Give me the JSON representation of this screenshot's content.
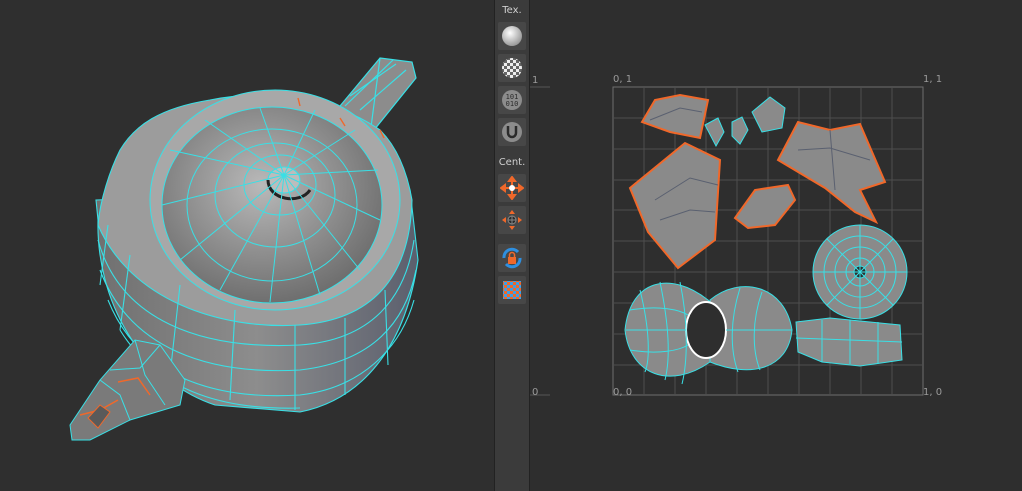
{
  "toolbar": {
    "texture_section_label": "Tex.",
    "center_section_label": "Cent.",
    "buttons": [
      {
        "name": "shaded-sphere-icon"
      },
      {
        "name": "checker-pattern-icon"
      },
      {
        "name": "binary-digits-icon"
      },
      {
        "name": "magnet-icon"
      },
      {
        "name": "center-move-icon"
      },
      {
        "name": "center-scatter-icon"
      },
      {
        "name": "rotate-lock-icon"
      },
      {
        "name": "checker-tile-icon"
      }
    ]
  },
  "uv_editor": {
    "corner_top_left": "0, 1",
    "corner_top_right": "1, 1",
    "corner_bottom_left": "0, 0",
    "corner_bottom_right": "1, 0",
    "ruler_top": "1",
    "ruler_bottom": "0"
  },
  "colors": {
    "wire": "#39e0e6",
    "seam": "#f0682a",
    "mesh_fill": "#8a8a8a",
    "background": "#2e2e2e"
  }
}
